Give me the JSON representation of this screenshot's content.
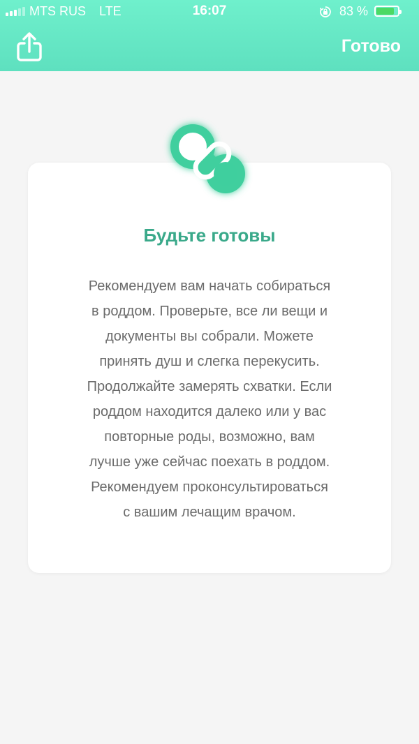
{
  "status_bar": {
    "carrier": "MTS RUS",
    "network": "LTE",
    "time": "16:07",
    "battery_percent": "83 %",
    "battery_level": 0.83,
    "signal_bars": 3,
    "signal_bars_total": 5
  },
  "header": {
    "share_icon": "share-icon",
    "done_label": "Готово",
    "accent_color": "#5ee0bf"
  },
  "card": {
    "icon": "pacifier-icon",
    "title": "Будьте готовы",
    "title_color": "#3aa98a",
    "body_lines": [
      "Рекомендуем вам начать собираться",
      "в роддом. Проверьте, все ли вещи и",
      "документы вы собрали. Можете",
      "принять душ и слегка перекусить.",
      "Продолжайте замерять схватки. Если",
      "роддом находится далеко или у вас",
      "повторные роды, возможно, вам",
      "лучше уже сейчас поехать в роддом.",
      "Рекомендуем проконсультироваться",
      "с вашим лечащим врачом."
    ]
  }
}
